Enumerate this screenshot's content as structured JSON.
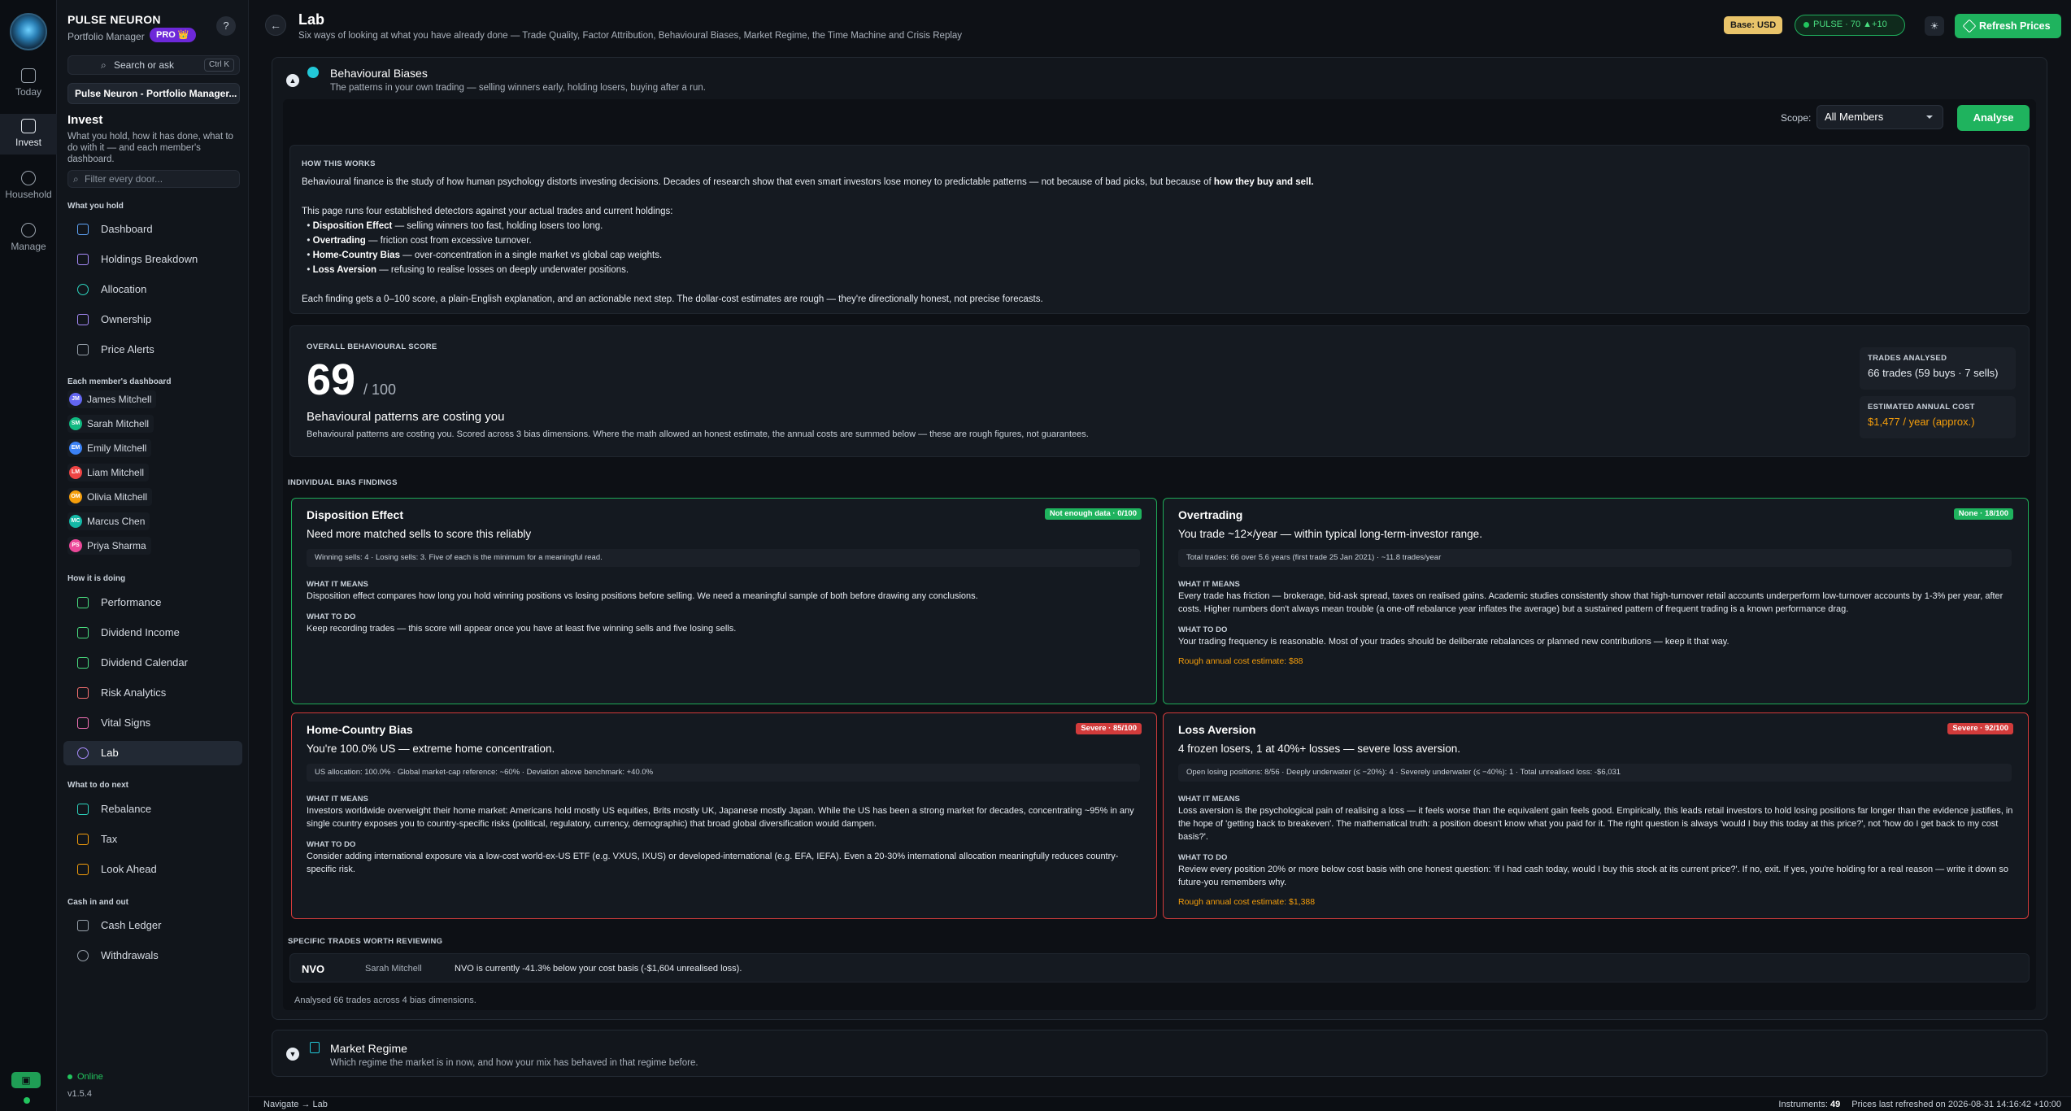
{
  "rail": {
    "items": [
      {
        "label": "Today"
      },
      {
        "label": "Invest"
      },
      {
        "label": "Household"
      },
      {
        "label": "Manage"
      }
    ]
  },
  "sidebar": {
    "brand": "PULSE NEURON",
    "role": "Portfolio Manager",
    "pro": "PRO 👑",
    "help": "?",
    "search_label": "Search or ask",
    "search_kbd": "Ctrl K",
    "portfolio": "Pulse Neuron - Portfolio Manager...",
    "section_title": "Invest",
    "section_desc": "What you hold, how it has done, what to do with it — and each member's dashboard.",
    "filter_placeholder": "Filter every door...",
    "groups": {
      "hold": "What you hold",
      "members": "Each member's dashboard",
      "doing": "How it is doing",
      "next": "What to do next",
      "cash": "Cash in and out"
    },
    "hold_items": [
      "Dashboard",
      "Holdings Breakdown",
      "Allocation",
      "Ownership",
      "Price Alerts"
    ],
    "members": [
      {
        "initials": "JM",
        "name": "James Mitchell",
        "color": "#6366f1"
      },
      {
        "initials": "SM",
        "name": "Sarah Mitchell",
        "color": "#10b981"
      },
      {
        "initials": "EM",
        "name": "Emily Mitchell",
        "color": "#3b82f6"
      },
      {
        "initials": "LM",
        "name": "Liam Mitchell",
        "color": "#ef4444"
      },
      {
        "initials": "OM",
        "name": "Olivia Mitchell",
        "color": "#f59e0b"
      },
      {
        "initials": "MC",
        "name": "Marcus Chen",
        "color": "#14b8a6"
      },
      {
        "initials": "PS",
        "name": "Priya Sharma",
        "color": "#ec4899"
      }
    ],
    "doing_items": [
      "Performance",
      "Dividend Income",
      "Dividend Calendar",
      "Risk Analytics",
      "Vital Signs",
      "Lab"
    ],
    "next_items": [
      "Rebalance",
      "Tax",
      "Look Ahead"
    ],
    "cash_items": [
      "Cash Ledger",
      "Withdrawals"
    ],
    "status": "Online",
    "version": "v1.5.4"
  },
  "header": {
    "back": "←",
    "title": "Lab",
    "subtitle": "Six ways of looking at what you have already done — Trade Quality, Factor Attribution, Behavioural Biases, Market Regime, the Time Machine and Crisis Replay",
    "base": "Base: USD",
    "pulse": "PULSE · 70  ▲+10",
    "refresh": "Refresh Prices"
  },
  "bias_panel": {
    "title": "Behavioural Biases",
    "subtitle": "The patterns in your own trading — selling winners early, holding losers, buying after a run.",
    "scope_label": "Scope:",
    "scope_value": "All Members",
    "analyse": "Analyse",
    "how": {
      "caption": "HOW THIS WORKS",
      "p1": "Behavioural finance is the study of how human psychology distorts investing decisions. Decades of research show that even smart investors lose money to predictable patterns — not because of bad picks, but because of",
      "p1_bold": "how they buy and sell.",
      "p2": "This page runs four established detectors against your actual trades and current holdings:",
      "list": [
        {
          "b": "Disposition Effect",
          "t": " — selling winners too fast, holding losers too long."
        },
        {
          "b": "Overtrading",
          "t": " — friction cost from excessive turnover."
        },
        {
          "b": "Home-Country Bias",
          "t": " — over-concentration in a single market vs global cap weights."
        },
        {
          "b": "Loss Aversion",
          "t": " — refusing to realise losses on deeply underwater positions."
        }
      ],
      "p3": "Each finding gets a 0–100 score, a plain-English explanation, and an actionable next step. The dollar-cost estimates are rough — they're directionally honest, not precise forecasts."
    },
    "score": {
      "caption": "OVERALL BEHAVIOURAL SCORE",
      "value": "69",
      "out_of": "/ 100",
      "headline": "Behavioural patterns are costing you",
      "desc": "Behavioural patterns are costing you. Scored across 3 bias dimensions. Where the math allowed an honest estimate, the annual costs are summed below — these are rough figures, not guarantees.",
      "trades_caption": "TRADES ANALYSED",
      "trades_value": "66 trades (59 buys · 7 sells)",
      "cost_caption": "ESTIMATED ANNUAL COST",
      "cost_value": "$1,477 / year (approx.)"
    },
    "findings_caption": "INDIVIDUAL BIAS FINDINGS",
    "findings": [
      {
        "title": "Disposition Effect",
        "badge": "Not enough data · 0/100",
        "headline": "Need more matched sells to score this reliably",
        "metrics": "Winning sells: 4 · Losing sells: 3. Five of each is the minimum for a meaningful read.",
        "means_label": "WHAT IT MEANS",
        "means": "Disposition effect compares how long you hold winning positions vs losing positions before selling. We need a meaningful sample of both before drawing any conclusions.",
        "todo_label": "WHAT TO DO",
        "todo": "Keep recording trades — this score will appear once you have at least five winning sells and five losing sells.",
        "estimate": ""
      },
      {
        "title": "Overtrading",
        "badge": "None · 18/100",
        "headline": "You trade ~12×/year — within typical long-term-investor range.",
        "metrics": "Total trades: 66 over 5.6 years (first trade 25 Jan 2021) · ~11.8 trades/year",
        "means_label": "WHAT IT MEANS",
        "means": "Every trade has friction — brokerage, bid-ask spread, taxes on realised gains. Academic studies consistently show that high-turnover retail accounts underperform low-turnover accounts by 1-3% per year, after costs. Higher numbers don't always mean trouble (a one-off rebalance year inflates the average) but a sustained pattern of frequent trading is a known performance drag.",
        "todo_label": "WHAT TO DO",
        "todo": "Your trading frequency is reasonable. Most of your trades should be deliberate rebalances or planned new contributions — keep it that way.",
        "estimate": "Rough annual cost estimate:  $88"
      },
      {
        "title": "Home-Country Bias",
        "badge": "Severe · 85/100",
        "headline": "You're 100.0% US — extreme home concentration.",
        "metrics": "US allocation: 100.0% · Global market-cap reference: ~60% · Deviation above benchmark: +40.0%",
        "means_label": "WHAT IT MEANS",
        "means": "Investors worldwide overweight their home market: Americans hold mostly US equities, Brits mostly UK, Japanese mostly Japan. While the US has been a strong market for decades, concentrating ~95% in any single country exposes you to country-specific risks (political, regulatory, currency, demographic) that broad global diversification would dampen.",
        "todo_label": "WHAT TO DO",
        "todo": "Consider adding international exposure via a low-cost world-ex-US ETF (e.g. VXUS, IXUS) or developed-international (e.g. EFA, IEFA). Even a 20-30% international allocation meaningfully reduces country-specific risk.",
        "estimate": ""
      },
      {
        "title": "Loss Aversion",
        "badge": "Severe · 92/100",
        "headline": "4 frozen losers, 1 at 40%+ losses — severe loss aversion.",
        "metrics": "Open losing positions: 8/56 · Deeply underwater (≤ −20%): 4 · Severely underwater (≤ −40%): 1 · Total unrealised loss: -$6,031",
        "means_label": "WHAT IT MEANS",
        "means": "Loss aversion is the psychological pain of realising a loss — it feels worse than the equivalent gain feels good. Empirically, this leads retail investors to hold losing positions far longer than the evidence justifies, in the hope of 'getting back to breakeven'. The mathematical truth: a position doesn't know what you paid for it. The right question is always 'would I buy this today at this price?', not 'how do I get back to my cost basis?'.",
        "todo_label": "WHAT TO DO",
        "todo": "Review every position 20% or more below cost basis with one honest question: 'if I had cash today, would I buy this stock at its current price?'. If no, exit. If yes, you're holding for a real reason — write it down so future-you remembers why.",
        "estimate": "Rough annual cost estimate:  $1,388"
      }
    ],
    "trades_caption": "SPECIFIC TRADES WORTH REVIEWING",
    "trades": [
      {
        "ticker": "NVO",
        "member": "Sarah Mitchell",
        "desc": "NVO is currently -41.3% below your cost basis (-$1,604 unrealised loss)."
      }
    ],
    "analysed_note": "Analysed 66 trades across 4 bias dimensions."
  },
  "regime_panel": {
    "title": "Market Regime",
    "subtitle": "Which regime the market is in now, and how your mix has behaved in that regime before."
  },
  "footer": {
    "nav": "Navigate → Lab",
    "instruments_label": "Instruments:",
    "instruments": "49",
    "prices": "Prices last refreshed on 2026-08-31 14:16:42 +10:00"
  }
}
